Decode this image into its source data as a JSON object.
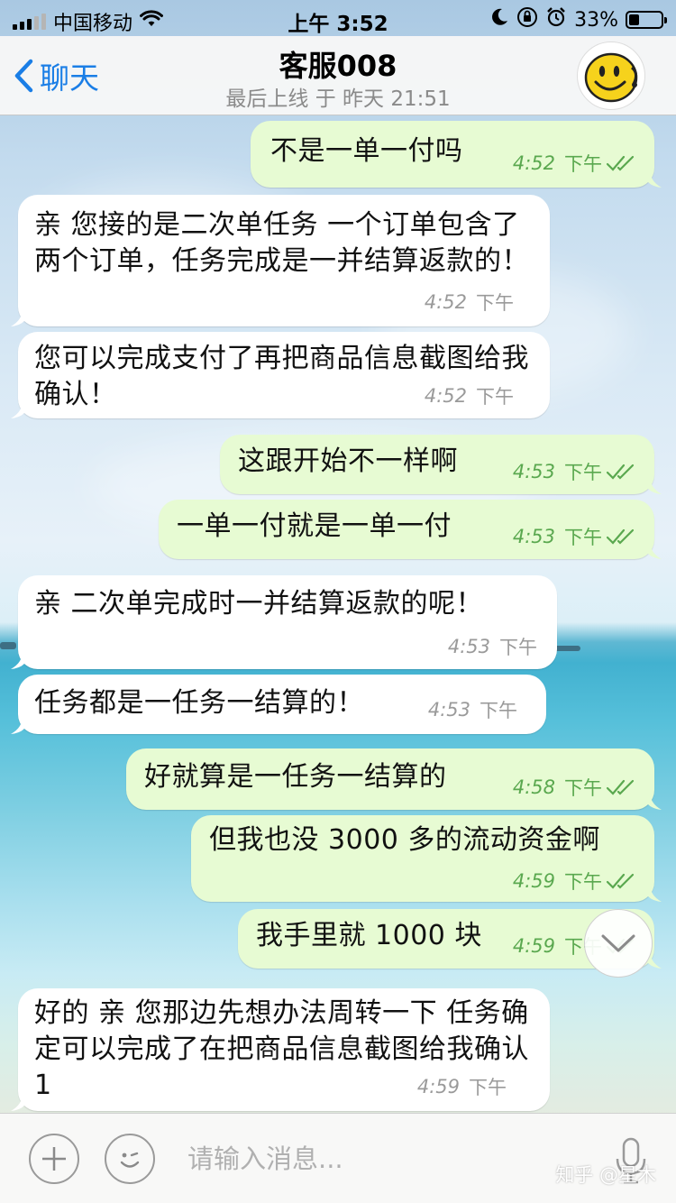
{
  "status_bar": {
    "carrier": "中国移动",
    "time": "上午 3:52",
    "battery": "33%",
    "battery_level": 0.33
  },
  "nav": {
    "back_label": "聊天",
    "title": "客服008",
    "subtitle": "最后上线 于 昨天 21:51"
  },
  "messages": [
    {
      "dir": "out",
      "text": "不是一单一付吗",
      "time": "4:52",
      "ampm": "下午",
      "read": true
    },
    {
      "dir": "in",
      "text": "亲 您接的是二次单任务 一个订单包含了两个订单，任务完成是一并结算返款的！",
      "time": "4:52",
      "ampm": "下午"
    },
    {
      "dir": "in",
      "text": "您可以完成支付了再把商品信息截图给我确认！",
      "time": "4:52",
      "ampm": "下午"
    },
    {
      "dir": "out",
      "text": "这跟开始不一样啊",
      "time": "4:53",
      "ampm": "下午",
      "read": true
    },
    {
      "dir": "out",
      "text": "一单一付就是一单一付",
      "time": "4:53",
      "ampm": "下午",
      "read": true
    },
    {
      "dir": "in",
      "text": "亲 二次单完成时一并结算返款的呢！",
      "time": "4:53",
      "ampm": "下午"
    },
    {
      "dir": "in",
      "text": "任务都是一任务一结算的！",
      "time": "4:53",
      "ampm": "下午"
    },
    {
      "dir": "out",
      "text": "好就算是一任务一结算的",
      "time": "4:58",
      "ampm": "下午",
      "read": true
    },
    {
      "dir": "out",
      "text": "但我也没 3000 多的流动资金啊",
      "time": "4:59",
      "ampm": "下午",
      "read": true
    },
    {
      "dir": "out",
      "text": "我手里就 1000 块",
      "time": "4:59",
      "ampm": "下午",
      "read": true
    },
    {
      "dir": "in",
      "text": "好的 亲 您那边先想办法周转一下 任务确定可以完成了在把商品信息截图给我确认1",
      "time": "4:59",
      "ampm": "下午"
    }
  ],
  "input": {
    "placeholder": "请输入消息..."
  },
  "watermark": "知乎 @星木",
  "colors": {
    "accent": "#1a7ee6",
    "outgoing_bubble": "#e7fbd3",
    "incoming_bubble": "#ffffff",
    "outgoing_meta": "#5aa84f"
  },
  "icons": [
    "back-chevron-icon",
    "wifi-icon",
    "moon-icon",
    "orientation-lock-icon",
    "alarm-icon",
    "smiley-avatar-icon",
    "chevron-down-icon",
    "plus-icon",
    "sticker-icon",
    "microphone-icon"
  ]
}
